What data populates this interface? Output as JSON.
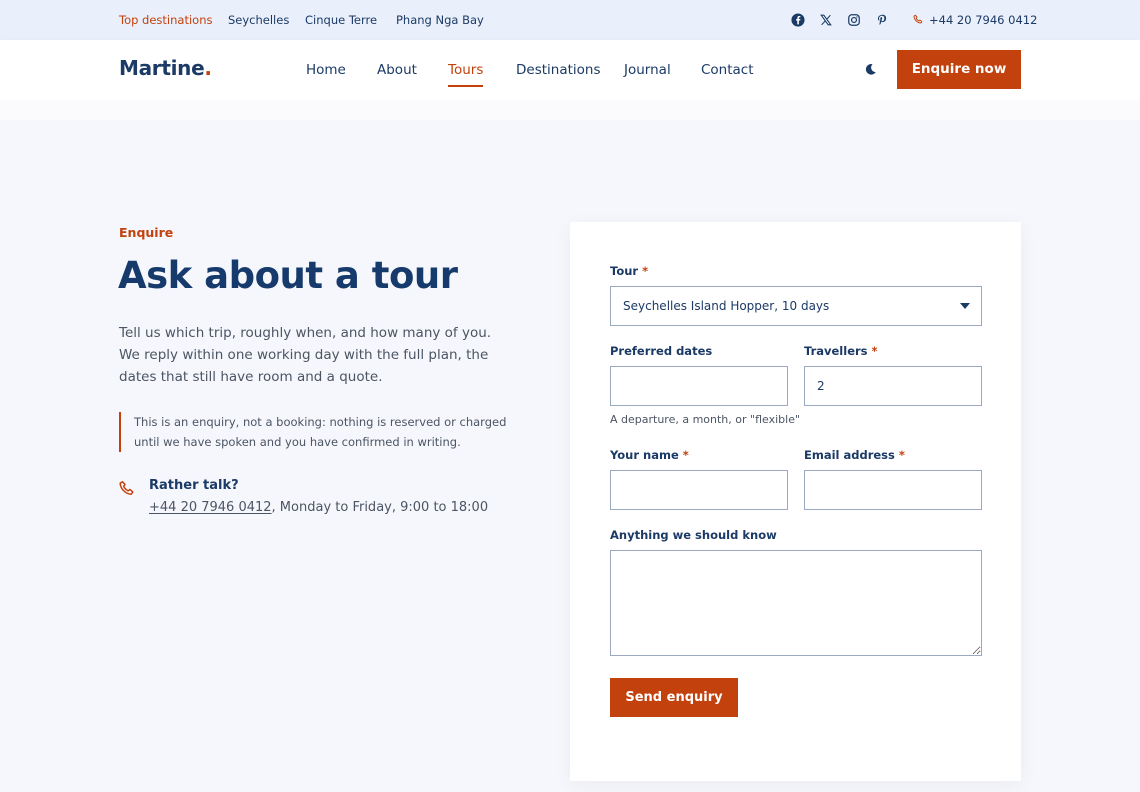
{
  "topbar": {
    "destinations": [
      "Top destinations",
      "Seychelles",
      "Cinque Terre",
      "Phang Nga Bay"
    ],
    "social": [
      "facebook-icon",
      "x-icon",
      "instagram-icon",
      "pinterest-icon"
    ],
    "phone": "+44 20 7946 0412"
  },
  "header": {
    "logo": "Martine",
    "logo_dot": ".",
    "nav": [
      "Home",
      "About",
      "Tours",
      "Destinations",
      "Journal",
      "Contact"
    ],
    "active_nav": "Tours",
    "cta": "Enquire now"
  },
  "intro": {
    "eyebrow": "Enquire",
    "title": "Ask about a tour",
    "lede": "Tell us which trip, roughly when, and how many of you. We reply within one working day with the full plan, the dates that still have room and a quote.",
    "note": "This is an enquiry, not a booking: nothing is reserved or charged until we have spoken and you have confirmed in writing.",
    "talk_title": "Rather talk?",
    "talk_phone": "+44 20 7946 0412",
    "talk_hours": ", Monday to Friday, 9:00 to 18:00"
  },
  "form": {
    "tour_label": "Tour",
    "tour_value": "Seychelles Island Hopper, 10 days",
    "dates_label": "Preferred dates",
    "dates_value": "",
    "dates_hint": "A departure, a month, or \"flexible\"",
    "travellers_label": "Travellers",
    "travellers_value": "2",
    "name_label": "Your name",
    "name_value": "",
    "email_label": "Email address",
    "email_value": "",
    "notes_label": "Anything we should know",
    "notes_value": "",
    "required_mark": "*",
    "submit": "Send enquiry"
  },
  "colors": {
    "accent": "#c2410c",
    "navy": "#1b3a66",
    "topbar_bg": "#eaf0fb",
    "page_bg": "#f6f7fc"
  }
}
